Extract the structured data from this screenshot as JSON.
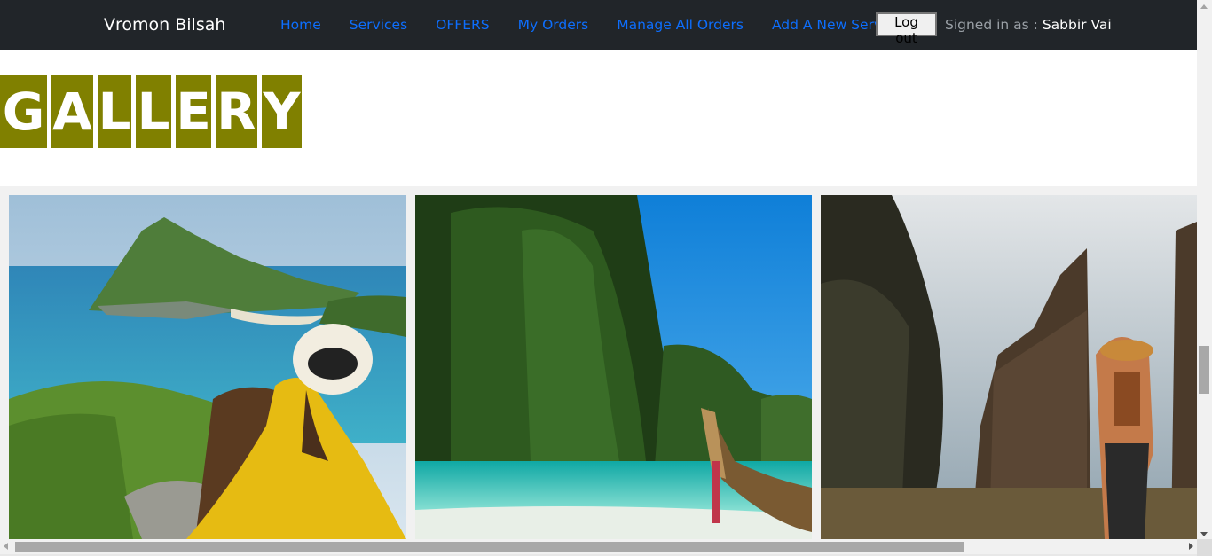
{
  "navbar": {
    "brand": "Vromon Bilsah",
    "links": [
      {
        "label": "Home"
      },
      {
        "label": "Services"
      },
      {
        "label": "OFFERS"
      },
      {
        "label": "My Orders"
      },
      {
        "label": "Manage All Orders"
      },
      {
        "label": "Add A New Service"
      }
    ],
    "logout_label": "Log out",
    "signed_prefix": "Signed in as : ",
    "user_name": "Sabbir Vai"
  },
  "gallery": {
    "letters": [
      "G",
      "A",
      "L",
      "L",
      "E",
      "R",
      "Y"
    ],
    "photos": [
      {
        "alt": "island-viewpoint-woman-yellow-dress"
      },
      {
        "alt": "limestone-cliff-beach-longtail-boat"
      },
      {
        "alt": "bali-temple-gate-traveler"
      }
    ]
  },
  "colors": {
    "navbar_bg": "#212529",
    "link": "#0d6efd",
    "gallery_letter_bg": "#808000"
  }
}
